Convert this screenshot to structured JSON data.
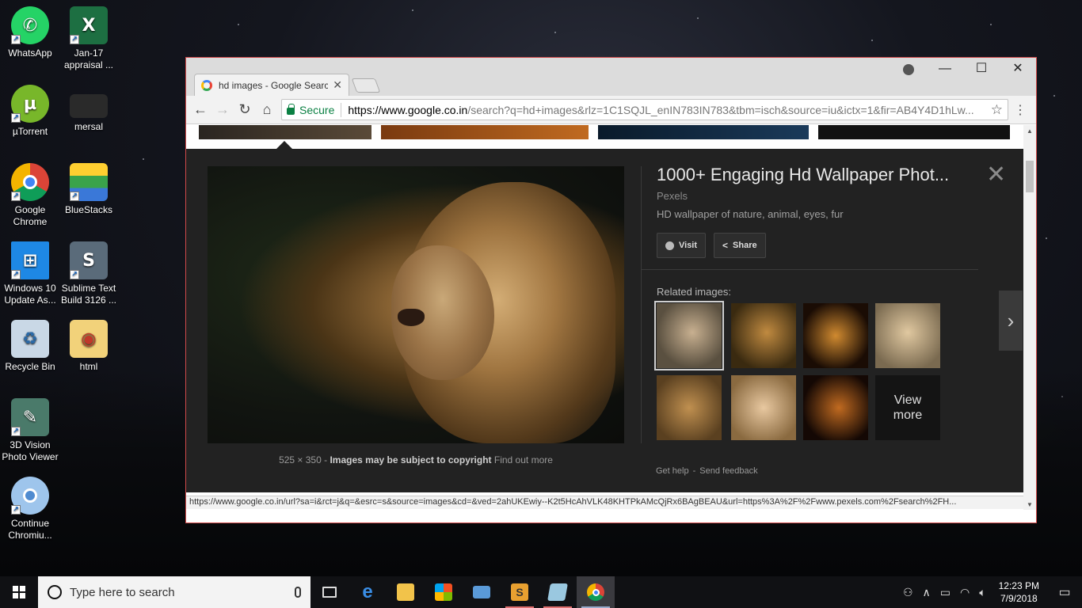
{
  "desktop": {
    "icons": [
      {
        "label": "WhatsApp",
        "color": "#25d366",
        "glyph": "✆"
      },
      {
        "label": "Jan-17 appraisal ...",
        "color": "#1d6f42",
        "glyph": "X"
      },
      {
        "label": "µTorrent",
        "color": "#78b72a",
        "glyph": "µ"
      },
      {
        "label": "mersal",
        "color": "#2a2a2a",
        "glyph": "▤"
      },
      {
        "label": "Google Chrome",
        "color": "#dd4b39",
        "glyph": "◉"
      },
      {
        "label": "BlueStacks",
        "color": "#3aa34a",
        "glyph": "◆"
      },
      {
        "label": "Windows 10 Update As...",
        "color": "#1e88e5",
        "glyph": "⊞"
      },
      {
        "label": "Sublime Text Build 3126 ...",
        "color": "#5a6b7a",
        "glyph": "S"
      },
      {
        "label": "Recycle Bin",
        "color": "#7fa7c9",
        "glyph": "♻"
      },
      {
        "label": "html",
        "color": "#e0b040",
        "glyph": "◉"
      },
      {
        "label": "3D Vision Photo Viewer",
        "color": "#4a7a6a",
        "glyph": "✎"
      },
      {
        "label": "Continue Chromiu...",
        "color": "#6a9ed8",
        "glyph": "◉"
      }
    ]
  },
  "browser": {
    "tab_title": "hd images - Google Search",
    "secure_label": "Secure",
    "url_host": "https://www.google.co.in",
    "url_rest": "/search?q=hd+images&rlz=1C1SQJL_enIN783IN783&tbm=isch&source=iu&ictx=1&fir=AB4Y4D1hLw...",
    "status_url": "https://www.google.co.in/url?sa=i&rct=j&q=&esrc=s&source=images&cd=&ved=2ahUKEwiy--K2t5HcAhVLK48KHTPkAMcQjRx6BAgBEAU&url=https%3A%2F%2Fwww.pexels.com%2Fsearch%2FH..."
  },
  "preview": {
    "title": "1000+ Engaging Hd Wallpaper Phot...",
    "site": "Pexels",
    "description": "HD wallpaper of nature, animal, eyes, fur",
    "visit_label": "Visit",
    "share_label": "Share",
    "dimensions": "525 × 350",
    "separator": "-",
    "copyright": "Images may be subject to copyright",
    "find_out_more": "Find out more",
    "related_label": "Related images:",
    "view_more": "View more",
    "get_help": "Get help",
    "send_feedback": "Send feedback"
  },
  "related_colors": [
    "#8a7a60",
    "#7a5a2a",
    "#6a3a1a",
    "#9a8a70",
    "#7a6040",
    "#b09070",
    "#5a3010"
  ],
  "taskbar": {
    "search_placeholder": "Type here to search",
    "time": "12:23 PM",
    "date": "7/9/2018"
  }
}
